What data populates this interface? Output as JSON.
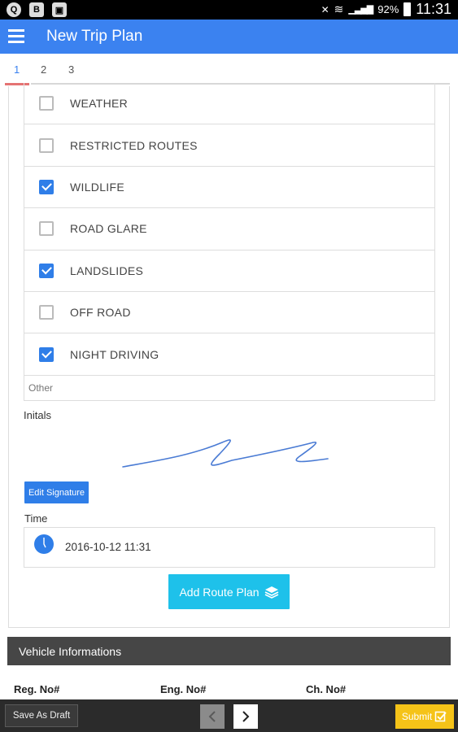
{
  "status_bar": {
    "battery": "92%",
    "time": "11:31",
    "left_icons": [
      "q-notification-icon",
      "document-icon",
      "image-icon"
    ]
  },
  "app_bar": {
    "title": "New Trip Plan"
  },
  "steps": {
    "items": [
      "1",
      "2",
      "3"
    ],
    "active": "1",
    "accent_color": "#e57373"
  },
  "checklist": {
    "items": [
      {
        "label": "WEATHER",
        "checked": false
      },
      {
        "label": "RESTRICTED ROUTES",
        "checked": false
      },
      {
        "label": "WILDLIFE",
        "checked": true
      },
      {
        "label": "ROAD GLARE",
        "checked": false
      },
      {
        "label": "LANDSLIDES",
        "checked": true
      },
      {
        "label": "OFF ROAD",
        "checked": false
      },
      {
        "label": "NIGHT DRIVING",
        "checked": true
      }
    ],
    "other_placeholder": "Other"
  },
  "initials": {
    "label": "Initals",
    "edit_button": "Edit Signature"
  },
  "time": {
    "label": "Time",
    "value": "2016-10-12 11:31"
  },
  "add_route_button": "Add Route Plan",
  "vehicle_section": {
    "title": "Vehicle Informations",
    "columns": [
      "Reg. No#",
      "Eng. No#",
      "Ch. No#"
    ]
  },
  "bottom_bar": {
    "save_draft": "Save As Draft",
    "submit": "Submit"
  },
  "colors": {
    "primary": "#3b82f0",
    "checkbox": "#2f7ee8",
    "add_route": "#1ec1ea",
    "submit": "#f5c318",
    "section_bar": "#464646"
  }
}
